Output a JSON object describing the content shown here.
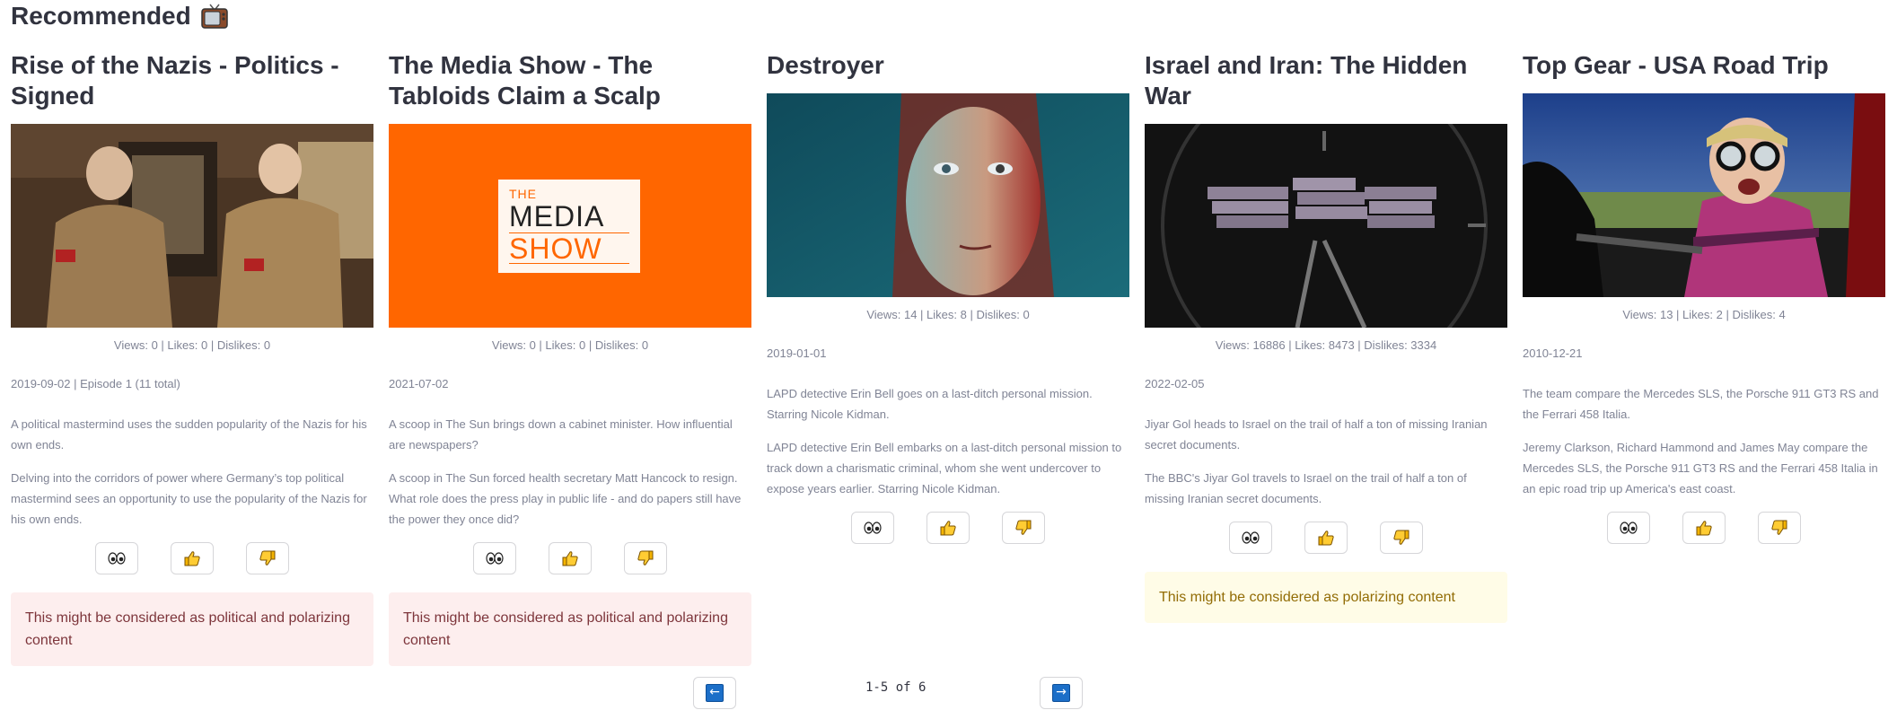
{
  "header": {
    "title": "Recommended"
  },
  "cards": [
    {
      "title": "Rise of the Nazis - Politics - Signed",
      "stats": "Views: 0 | Likes: 0 | Dislikes: 0",
      "meta": "2019-09-02 | Episode 1 (11 total)",
      "short_desc": "A political mastermind uses the sudden popularity of the Nazis for his own ends.",
      "long_desc": "Delving into the corridors of power where Germany’s top political mastermind sees an opportunity to use the popularity of the Nazis for his own ends.",
      "alert": "This might be considered as political and polarizing content",
      "alert_type": "red"
    },
    {
      "title": "The Media Show - The Tabloids Claim a Scalp",
      "stats": "Views: 0 | Likes: 0 | Dislikes: 0",
      "meta": "2021-07-02",
      "short_desc": "A scoop in The Sun brings down a cabinet minister. How influential are newspapers?",
      "long_desc": "A scoop in The Sun forced health secretary Matt Hancock to resign. What role does the press play in public life - and do papers still have the power they once did?",
      "alert": "This might be considered as political and polarizing content",
      "alert_type": "red",
      "logo_line1": "THE",
      "logo_line2": "MEDIA",
      "logo_line3": "SHOW"
    },
    {
      "title": "Destroyer",
      "stats": "Views: 14 | Likes: 8 | Dislikes: 0",
      "meta": "2019-01-01",
      "short_desc": "LAPD detective Erin Bell goes on a last-ditch personal mission. Starring Nicole Kidman.",
      "long_desc": "LAPD detective Erin Bell embarks on a last-ditch personal mission to track down a charismatic criminal, whom she went undercover to expose years earlier. Starring Nicole Kidman.",
      "alert": "",
      "alert_type": ""
    },
    {
      "title": "Israel and Iran: The Hidden War",
      "stats": "Views: 16886 | Likes: 8473 | Dislikes: 3334",
      "meta": "2022-02-05",
      "short_desc": "Jiyar Gol heads to Israel on the trail of half a ton of missing Iranian secret documents.",
      "long_desc": "The BBC's Jiyar Gol travels to Israel on the trail of half a ton of missing Iranian secret documents.",
      "alert": "This might be considered as polarizing content",
      "alert_type": "yellow"
    },
    {
      "title": "Top Gear - USA Road Trip",
      "stats": "Views: 13 | Likes: 2 | Dislikes: 4",
      "meta": "2010-12-21",
      "short_desc": "The team compare the Mercedes SLS, the Porsche 911 GT3 RS and the Ferrari 458 Italia.",
      "long_desc": "Jeremy Clarkson, Richard Hammond and James May compare the Mercedes SLS, the Porsche 911 GT3 RS and the Ferrari 458 Italia in an epic road trip up America's east coast.",
      "alert": "",
      "alert_type": ""
    }
  ],
  "icons": {
    "view": "eyes-icon",
    "like": "thumbs-up-icon",
    "dislike": "thumbs-down-icon",
    "prev": "left-arrow-icon",
    "next": "right-arrow-icon",
    "header": "television-icon"
  },
  "pagination": {
    "label": "1-5 of 6",
    "prev_glyph": "←",
    "next_glyph": "→"
  },
  "colors": {
    "media_show_orange": "#ff6600",
    "alert_red_bg": "#fdeeee",
    "alert_yellow_bg": "#fffce7",
    "arrow_blue": "#1c6fc8"
  }
}
